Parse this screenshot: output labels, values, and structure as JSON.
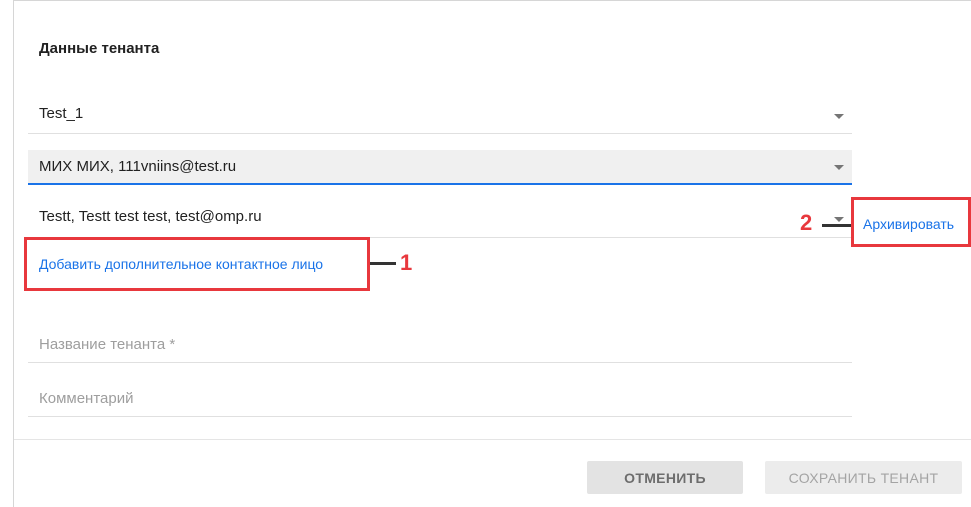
{
  "form": {
    "section_title": "Данные тенанта",
    "tenant_select": {
      "value": "Test_1"
    },
    "contact_primary": {
      "value": "МИХ МИХ, 111vniins@test.ru"
    },
    "contact_additional": {
      "value": "Testt, Testt test test, test@omp.ru"
    },
    "archive_link": "Архивировать",
    "add_contact_link": "Добавить дополнительное контактное лицо",
    "tenant_name": {
      "placeholder": "Название тенанта *",
      "value": ""
    },
    "comment": {
      "placeholder": "Комментарий",
      "value": ""
    }
  },
  "annotations": {
    "callout_1": "1",
    "callout_2": "2",
    "highlight_color": "#e8383d"
  },
  "footer": {
    "cancel_label": "ОТМЕНИТЬ",
    "save_label": "СОХРАНИТЬ ТЕНАНТ"
  },
  "colors": {
    "link": "#1a73e8",
    "focus_underline": "#1a73e8",
    "annotation_red": "#e8383d"
  },
  "icons": {
    "dropdown": "chevron-down-icon"
  }
}
